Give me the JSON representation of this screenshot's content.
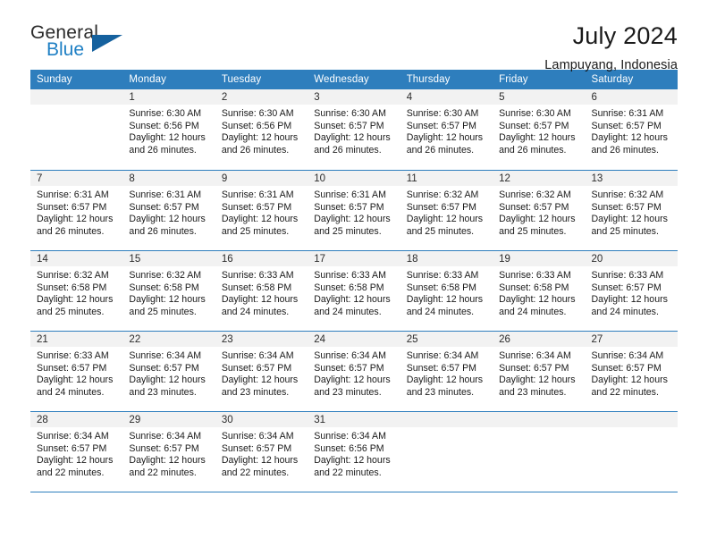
{
  "logo": {
    "line1": "General",
    "line2": "Blue",
    "triangle_color": "#15619e",
    "blue_color": "#1e7fc4",
    "icon": "triangle-logo-icon"
  },
  "header": {
    "title": "July 2024",
    "location": "Lampuyang, Indonesia"
  },
  "theme": {
    "header_blue": "#2e7ebd",
    "daynum_bg": "#f2f2f2",
    "text": "#1a1a1a"
  },
  "weekdays": [
    "Sunday",
    "Monday",
    "Tuesday",
    "Wednesday",
    "Thursday",
    "Friday",
    "Saturday"
  ],
  "labels": {
    "sunrise": "Sunrise:",
    "sunset": "Sunset:",
    "daylight": "Daylight:"
  },
  "weeks": [
    [
      {
        "day": "",
        "sunrise": "",
        "sunset": "",
        "daylight_1": "",
        "daylight_2": ""
      },
      {
        "day": "1",
        "sunrise": "Sunrise: 6:30 AM",
        "sunset": "Sunset: 6:56 PM",
        "daylight_1": "Daylight: 12 hours",
        "daylight_2": "and 26 minutes."
      },
      {
        "day": "2",
        "sunrise": "Sunrise: 6:30 AM",
        "sunset": "Sunset: 6:56 PM",
        "daylight_1": "Daylight: 12 hours",
        "daylight_2": "and 26 minutes."
      },
      {
        "day": "3",
        "sunrise": "Sunrise: 6:30 AM",
        "sunset": "Sunset: 6:57 PM",
        "daylight_1": "Daylight: 12 hours",
        "daylight_2": "and 26 minutes."
      },
      {
        "day": "4",
        "sunrise": "Sunrise: 6:30 AM",
        "sunset": "Sunset: 6:57 PM",
        "daylight_1": "Daylight: 12 hours",
        "daylight_2": "and 26 minutes."
      },
      {
        "day": "5",
        "sunrise": "Sunrise: 6:30 AM",
        "sunset": "Sunset: 6:57 PM",
        "daylight_1": "Daylight: 12 hours",
        "daylight_2": "and 26 minutes."
      },
      {
        "day": "6",
        "sunrise": "Sunrise: 6:31 AM",
        "sunset": "Sunset: 6:57 PM",
        "daylight_1": "Daylight: 12 hours",
        "daylight_2": "and 26 minutes."
      }
    ],
    [
      {
        "day": "7",
        "sunrise": "Sunrise: 6:31 AM",
        "sunset": "Sunset: 6:57 PM",
        "daylight_1": "Daylight: 12 hours",
        "daylight_2": "and 26 minutes."
      },
      {
        "day": "8",
        "sunrise": "Sunrise: 6:31 AM",
        "sunset": "Sunset: 6:57 PM",
        "daylight_1": "Daylight: 12 hours",
        "daylight_2": "and 26 minutes."
      },
      {
        "day": "9",
        "sunrise": "Sunrise: 6:31 AM",
        "sunset": "Sunset: 6:57 PM",
        "daylight_1": "Daylight: 12 hours",
        "daylight_2": "and 25 minutes."
      },
      {
        "day": "10",
        "sunrise": "Sunrise: 6:31 AM",
        "sunset": "Sunset: 6:57 PM",
        "daylight_1": "Daylight: 12 hours",
        "daylight_2": "and 25 minutes."
      },
      {
        "day": "11",
        "sunrise": "Sunrise: 6:32 AM",
        "sunset": "Sunset: 6:57 PM",
        "daylight_1": "Daylight: 12 hours",
        "daylight_2": "and 25 minutes."
      },
      {
        "day": "12",
        "sunrise": "Sunrise: 6:32 AM",
        "sunset": "Sunset: 6:57 PM",
        "daylight_1": "Daylight: 12 hours",
        "daylight_2": "and 25 minutes."
      },
      {
        "day": "13",
        "sunrise": "Sunrise: 6:32 AM",
        "sunset": "Sunset: 6:57 PM",
        "daylight_1": "Daylight: 12 hours",
        "daylight_2": "and 25 minutes."
      }
    ],
    [
      {
        "day": "14",
        "sunrise": "Sunrise: 6:32 AM",
        "sunset": "Sunset: 6:58 PM",
        "daylight_1": "Daylight: 12 hours",
        "daylight_2": "and 25 minutes."
      },
      {
        "day": "15",
        "sunrise": "Sunrise: 6:32 AM",
        "sunset": "Sunset: 6:58 PM",
        "daylight_1": "Daylight: 12 hours",
        "daylight_2": "and 25 minutes."
      },
      {
        "day": "16",
        "sunrise": "Sunrise: 6:33 AM",
        "sunset": "Sunset: 6:58 PM",
        "daylight_1": "Daylight: 12 hours",
        "daylight_2": "and 24 minutes."
      },
      {
        "day": "17",
        "sunrise": "Sunrise: 6:33 AM",
        "sunset": "Sunset: 6:58 PM",
        "daylight_1": "Daylight: 12 hours",
        "daylight_2": "and 24 minutes."
      },
      {
        "day": "18",
        "sunrise": "Sunrise: 6:33 AM",
        "sunset": "Sunset: 6:58 PM",
        "daylight_1": "Daylight: 12 hours",
        "daylight_2": "and 24 minutes."
      },
      {
        "day": "19",
        "sunrise": "Sunrise: 6:33 AM",
        "sunset": "Sunset: 6:58 PM",
        "daylight_1": "Daylight: 12 hours",
        "daylight_2": "and 24 minutes."
      },
      {
        "day": "20",
        "sunrise": "Sunrise: 6:33 AM",
        "sunset": "Sunset: 6:57 PM",
        "daylight_1": "Daylight: 12 hours",
        "daylight_2": "and 24 minutes."
      }
    ],
    [
      {
        "day": "21",
        "sunrise": "Sunrise: 6:33 AM",
        "sunset": "Sunset: 6:57 PM",
        "daylight_1": "Daylight: 12 hours",
        "daylight_2": "and 24 minutes."
      },
      {
        "day": "22",
        "sunrise": "Sunrise: 6:34 AM",
        "sunset": "Sunset: 6:57 PM",
        "daylight_1": "Daylight: 12 hours",
        "daylight_2": "and 23 minutes."
      },
      {
        "day": "23",
        "sunrise": "Sunrise: 6:34 AM",
        "sunset": "Sunset: 6:57 PM",
        "daylight_1": "Daylight: 12 hours",
        "daylight_2": "and 23 minutes."
      },
      {
        "day": "24",
        "sunrise": "Sunrise: 6:34 AM",
        "sunset": "Sunset: 6:57 PM",
        "daylight_1": "Daylight: 12 hours",
        "daylight_2": "and 23 minutes."
      },
      {
        "day": "25",
        "sunrise": "Sunrise: 6:34 AM",
        "sunset": "Sunset: 6:57 PM",
        "daylight_1": "Daylight: 12 hours",
        "daylight_2": "and 23 minutes."
      },
      {
        "day": "26",
        "sunrise": "Sunrise: 6:34 AM",
        "sunset": "Sunset: 6:57 PM",
        "daylight_1": "Daylight: 12 hours",
        "daylight_2": "and 23 minutes."
      },
      {
        "day": "27",
        "sunrise": "Sunrise: 6:34 AM",
        "sunset": "Sunset: 6:57 PM",
        "daylight_1": "Daylight: 12 hours",
        "daylight_2": "and 22 minutes."
      }
    ],
    [
      {
        "day": "28",
        "sunrise": "Sunrise: 6:34 AM",
        "sunset": "Sunset: 6:57 PM",
        "daylight_1": "Daylight: 12 hours",
        "daylight_2": "and 22 minutes."
      },
      {
        "day": "29",
        "sunrise": "Sunrise: 6:34 AM",
        "sunset": "Sunset: 6:57 PM",
        "daylight_1": "Daylight: 12 hours",
        "daylight_2": "and 22 minutes."
      },
      {
        "day": "30",
        "sunrise": "Sunrise: 6:34 AM",
        "sunset": "Sunset: 6:57 PM",
        "daylight_1": "Daylight: 12 hours",
        "daylight_2": "and 22 minutes."
      },
      {
        "day": "31",
        "sunrise": "Sunrise: 6:34 AM",
        "sunset": "Sunset: 6:56 PM",
        "daylight_1": "Daylight: 12 hours",
        "daylight_2": "and 22 minutes."
      },
      {
        "day": "",
        "sunrise": "",
        "sunset": "",
        "daylight_1": "",
        "daylight_2": ""
      },
      {
        "day": "",
        "sunrise": "",
        "sunset": "",
        "daylight_1": "",
        "daylight_2": ""
      },
      {
        "day": "",
        "sunrise": "",
        "sunset": "",
        "daylight_1": "",
        "daylight_2": ""
      }
    ]
  ]
}
